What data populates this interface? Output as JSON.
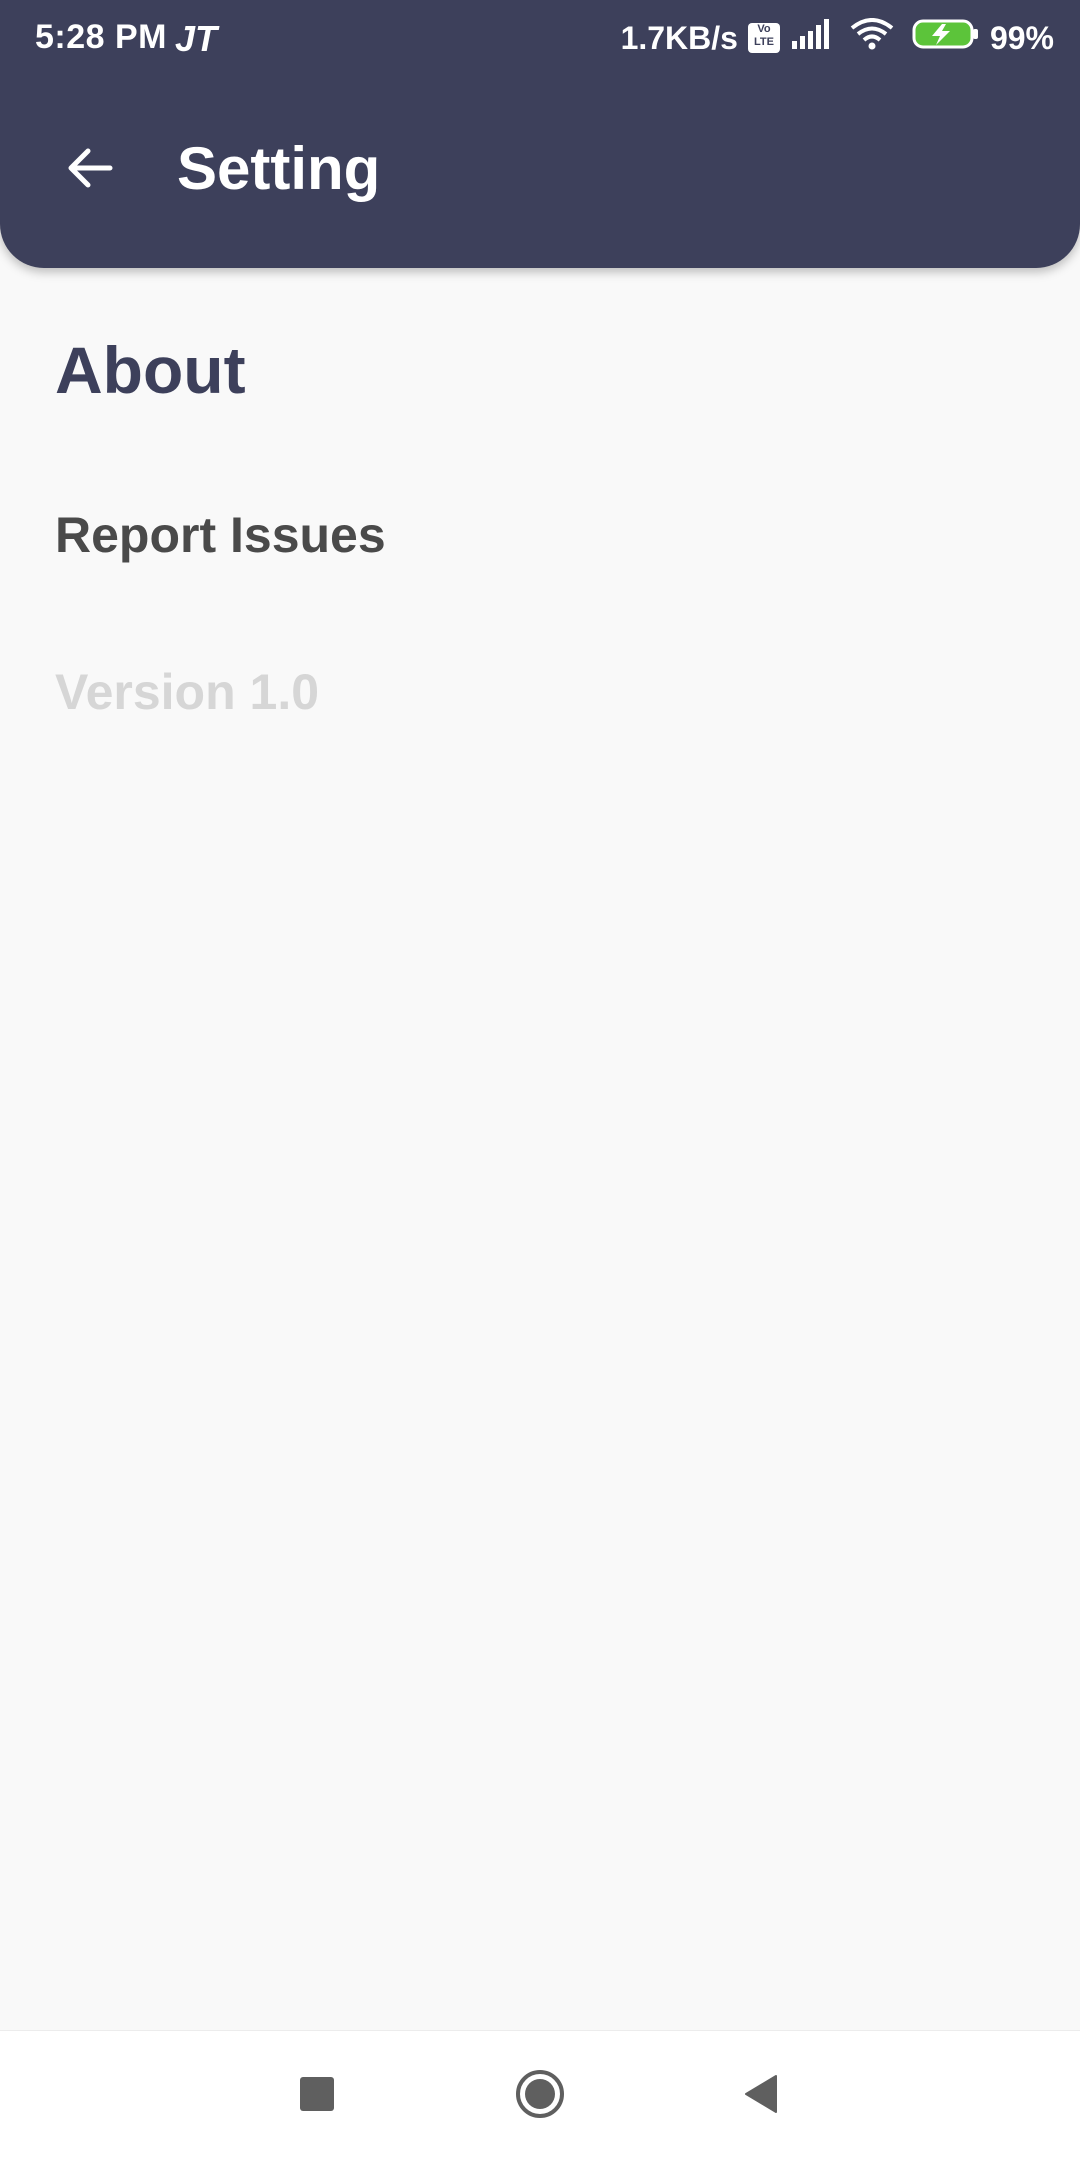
{
  "status_bar": {
    "time": "5:28 PM",
    "carrier": "JT",
    "network_speed": "1.7KB/s",
    "volte_top": "Vo",
    "volte_bottom": "LTE",
    "battery": "99%"
  },
  "toolbar": {
    "back_icon": "arrow-left-icon",
    "title": "Setting"
  },
  "content": {
    "section_title": "About",
    "items": [
      {
        "label": "Report Issues"
      },
      {
        "label": "Version 1.0"
      }
    ]
  },
  "nav_bar": {
    "icons": [
      "recents-square-icon",
      "home-circle-icon",
      "back-triangle-icon"
    ]
  },
  "colors": {
    "primary": "#3d405b",
    "background": "#f9f9f9",
    "item_text": "#4a4a4a",
    "muted_text": "#d6d6d6",
    "battery_green": "#5cc43a"
  }
}
